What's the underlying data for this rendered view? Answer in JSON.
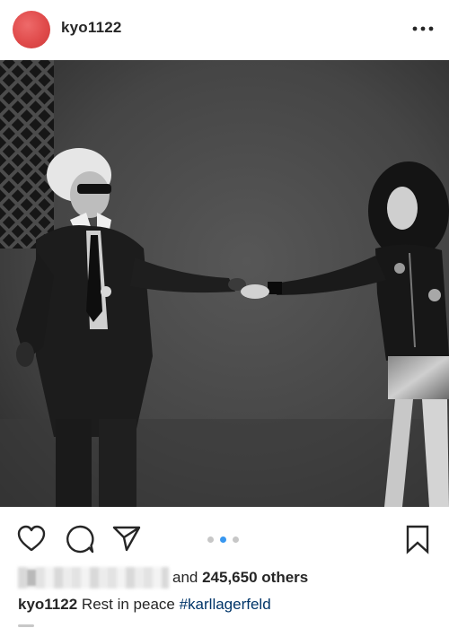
{
  "post": {
    "username": "kyo1122",
    "more_icon": "more-horizontal-icon",
    "avatar_color": "#e04b4b"
  },
  "photo": {
    "carousel_total": 3,
    "carousel_active": 2
  },
  "actions": {
    "like_icon": "heart-icon",
    "comment_icon": "comment-bubble-icon",
    "share_icon": "paper-plane-icon",
    "save_icon": "bookmark-icon"
  },
  "likes": {
    "prefix": "and ",
    "count_text": "245,650 others"
  },
  "caption": {
    "username": "kyo1122",
    "text": " Rest in peace ",
    "hashtag": "#karllagerfeld",
    "hashtag_color": "#003569"
  }
}
